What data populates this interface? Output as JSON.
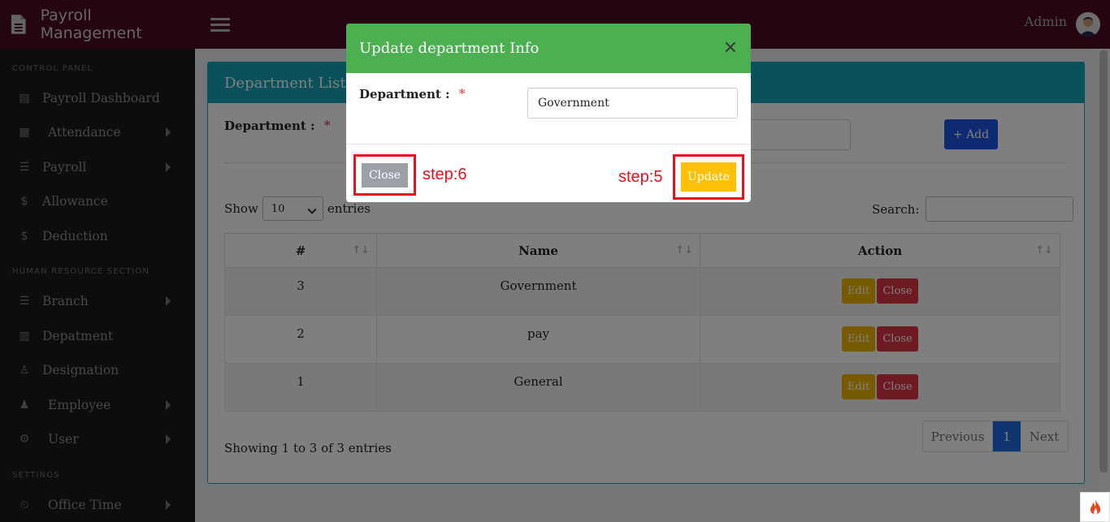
{
  "app": {
    "title": "Payroll Management",
    "user_name": "Admin"
  },
  "sidebar": {
    "sections": [
      "CONTROL PANEL",
      "HUMAN RESOURCE SECTION",
      "SETTINGS"
    ],
    "items": [
      {
        "label": "Payroll Dashboard",
        "icon": "document-icon"
      },
      {
        "label": "Attendance",
        "icon": "calendar-icon"
      },
      {
        "label": "Payroll",
        "icon": "list-icon"
      },
      {
        "label": "Allowance",
        "icon": "dollar-icon"
      },
      {
        "label": "Deduction",
        "icon": "dollar-slash-icon"
      },
      {
        "label": "Branch",
        "icon": "list-icon"
      },
      {
        "label": "Depatment",
        "icon": "table-icon"
      },
      {
        "label": "Designation",
        "icon": "user-icon"
      },
      {
        "label": "Employee",
        "icon": "users-icon"
      },
      {
        "label": "User",
        "icon": "user-cog-icon"
      },
      {
        "label": "Office Time",
        "icon": "clock-user-icon"
      }
    ]
  },
  "page": {
    "card_title": "Department List",
    "form_label": "Department :",
    "required_mark": "*",
    "add_button": "+ Add",
    "show_label": "Show",
    "entries_value": "10",
    "entries_label": "entries",
    "search_label": "Search:",
    "table": {
      "headers": [
        "#",
        "Name",
        "Action"
      ],
      "rows": [
        {
          "id": "3",
          "name": "Government"
        },
        {
          "id": "2",
          "name": "pay"
        },
        {
          "id": "1",
          "name": "General"
        }
      ],
      "edit_label": "Edit",
      "close_label": "Close"
    },
    "info_text": "Showing 1 to 3 of 3 entries",
    "pagination": {
      "previous": "Previous",
      "current": "1",
      "next": "Next"
    }
  },
  "modal": {
    "title": "Update department Info",
    "close_x": "×",
    "field_label": "Department :",
    "required_mark": "*",
    "field_value": "Government",
    "close_button": "Close",
    "update_button": "Update",
    "step_close": "step:6",
    "step_update": "step:5"
  },
  "colors": {
    "topbar": "#4a0a22",
    "sidebar": "#1a1b1f",
    "modal_header": "#4caf50",
    "card_header": "#17a2b8",
    "highlight": "#e8101a",
    "update_button": "#ffc107"
  }
}
